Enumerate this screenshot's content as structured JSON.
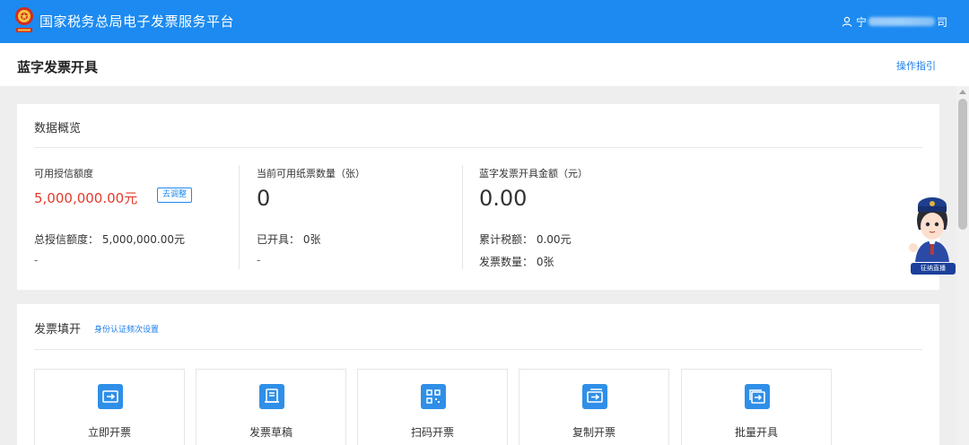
{
  "header": {
    "app_title": "国家税务总局电子发票服务平台",
    "user_prefix": "宁",
    "user_suffix": "司",
    "brand_color": "#1c8af0"
  },
  "page": {
    "title": "蓝字发票开具",
    "guide_link": "操作指引"
  },
  "overview": {
    "title": "数据概览",
    "stats": [
      {
        "label": "可用授信额度",
        "value": "5,000,000.00元",
        "action": "去调整",
        "sub_lines": [
          "总授信额度：  5,000,000.00元"
        ],
        "dash": "-"
      },
      {
        "label": "当前可用纸票数量（张）",
        "value": "0",
        "sub_lines": [
          "已开具：   0张"
        ],
        "dash": "-"
      },
      {
        "label": "蓝字发票开具金额（元）",
        "value": "0.00",
        "sub_lines": [
          "累计税额：   0.00元",
          "发票数量：   0张"
        ]
      }
    ]
  },
  "invoice_fill": {
    "title": "发票填开",
    "identity_link": "身份认证频次设置",
    "tiles": [
      {
        "label": "立即开票",
        "icon": "invoice-ticket-icon"
      },
      {
        "label": "发票草稿",
        "icon": "draft-document-icon"
      },
      {
        "label": "扫码开票",
        "icon": "qr-code-icon"
      },
      {
        "label": "复制开票",
        "icon": "copy-invoice-icon"
      },
      {
        "label": "批量开具",
        "icon": "batch-invoice-icon"
      }
    ]
  },
  "mascot": {
    "caption": "征纳直播"
  },
  "colors": {
    "accent": "#1c8af0",
    "credit_red": "#e5392b",
    "link_blue": "#1c7ee8",
    "page_bg": "#eeeeee"
  }
}
